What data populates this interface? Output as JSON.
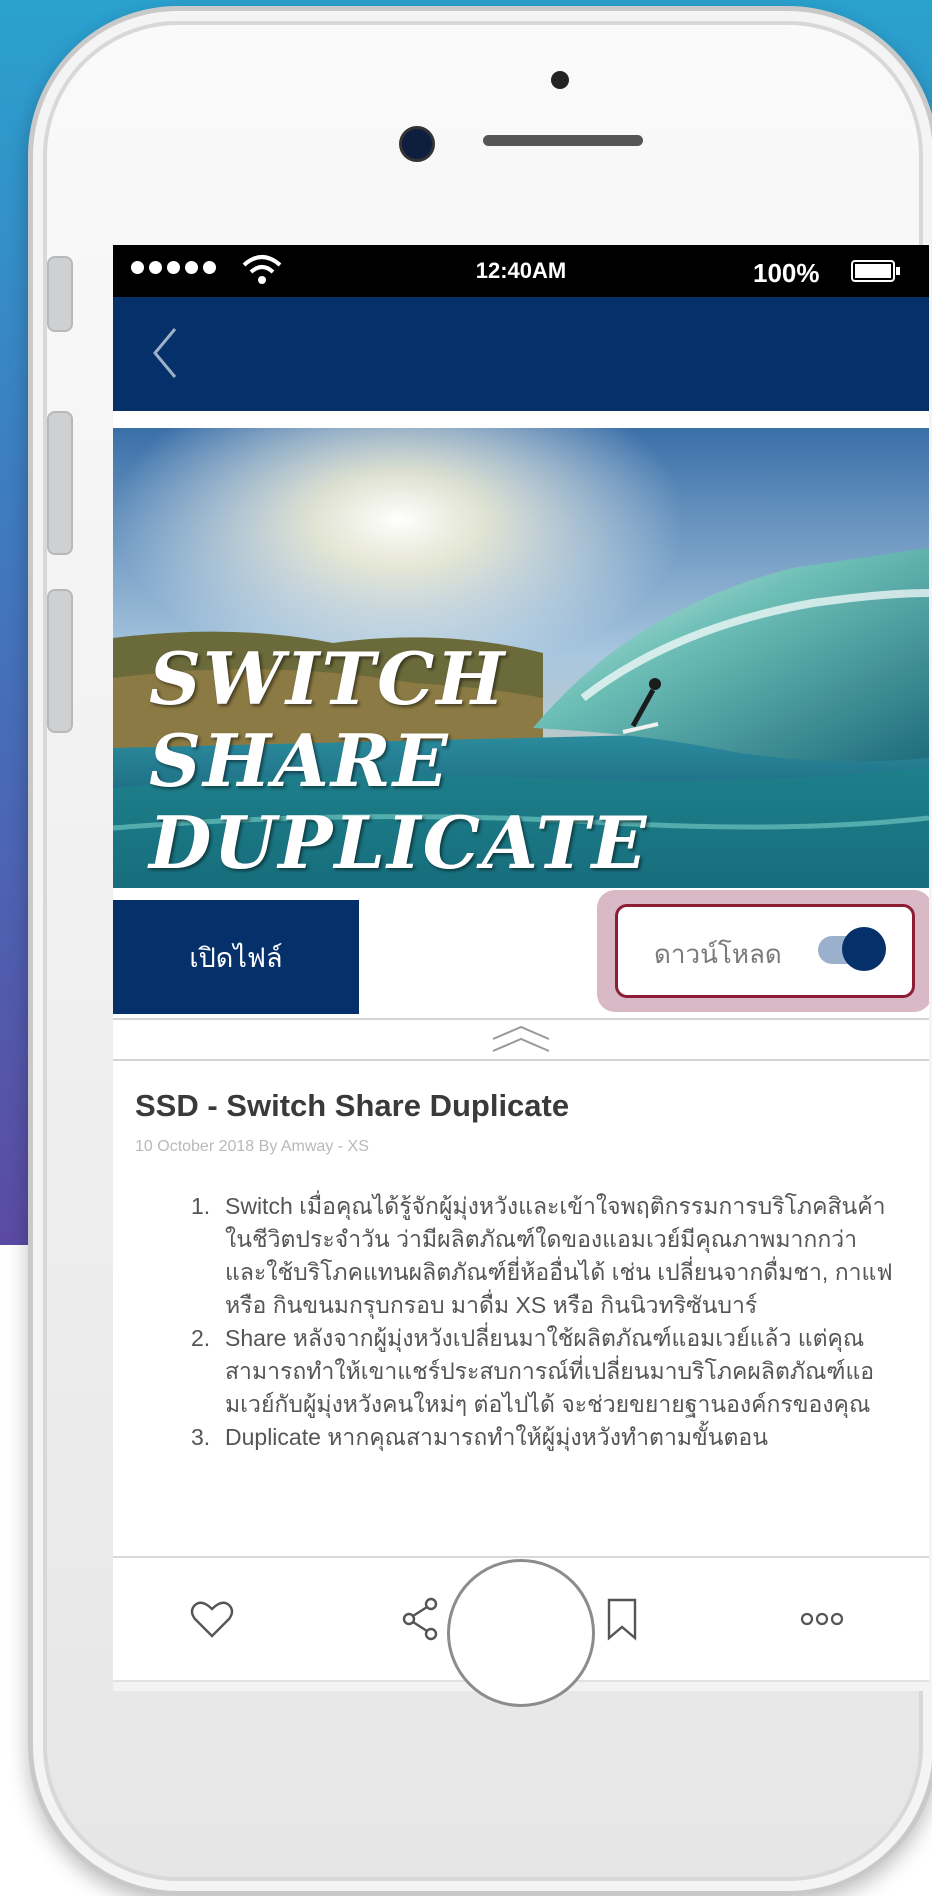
{
  "status_bar": {
    "time": "12:40AM",
    "battery": "100%"
  },
  "hero": {
    "title_lines": [
      "SWITCH",
      "SHARE",
      "DUPLICATE"
    ]
  },
  "actions": {
    "open_file_label": "เปิดไฟล์",
    "download_label": "ดาวน์โหลด",
    "download_toggle_on": true
  },
  "article": {
    "title": "SSD - Switch Share Duplicate",
    "meta": "10 October 2018 By Amway - XS",
    "items": [
      {
        "num": "1.",
        "text": "Switch  เมื่อคุณได้รู้จักผู้มุ่งหวังและเข้าใจพฤติกรรมการบริโภคสินค้าในชีวิตประจำวัน ว่ามีผลิตภัณฑ์ใดของแอมเวย์มีคุณภาพมากกว่า และใช้บริโภคแทนผลิตภัณฑ์ยี่ห้ออื่นได้ เช่น เปลี่ยนจากดื่มชา, กาแฟ หรือ กินขนมกรุบกรอบ มาดื่ม XS หรือ กินนิวทริซันบาร์"
      },
      {
        "num": "2.",
        "text": "Share  หลังจากผู้มุ่งหวังเปลี่ยนมาใช้ผลิตภัณฑ์แอมเวย์แล้ว แต่คุณสามารถทำให้เขาแชร์ประสบการณ์ที่เปลี่ยนมาบริโภคผลิตภัณฑ์แอมเวย์กับผู้มุ่งหวังคนใหม่ๆ ต่อไปได้ จะช่วยขยายฐานองค์กรของคุณ"
      },
      {
        "num": "3.",
        "text": " Duplicate หากคุณสามารถทำให้ผู้มุ่งหวังทำตามขั้นตอน"
      }
    ]
  },
  "toolbar": {
    "icons": [
      "heart-icon",
      "share-icon",
      "bookmark-icon",
      "more-icon"
    ],
    "more_label": "ooo"
  },
  "colors": {
    "navy": "#06306a",
    "highlight": "#d8b9c5",
    "highlight_border": "#8b1d35"
  }
}
